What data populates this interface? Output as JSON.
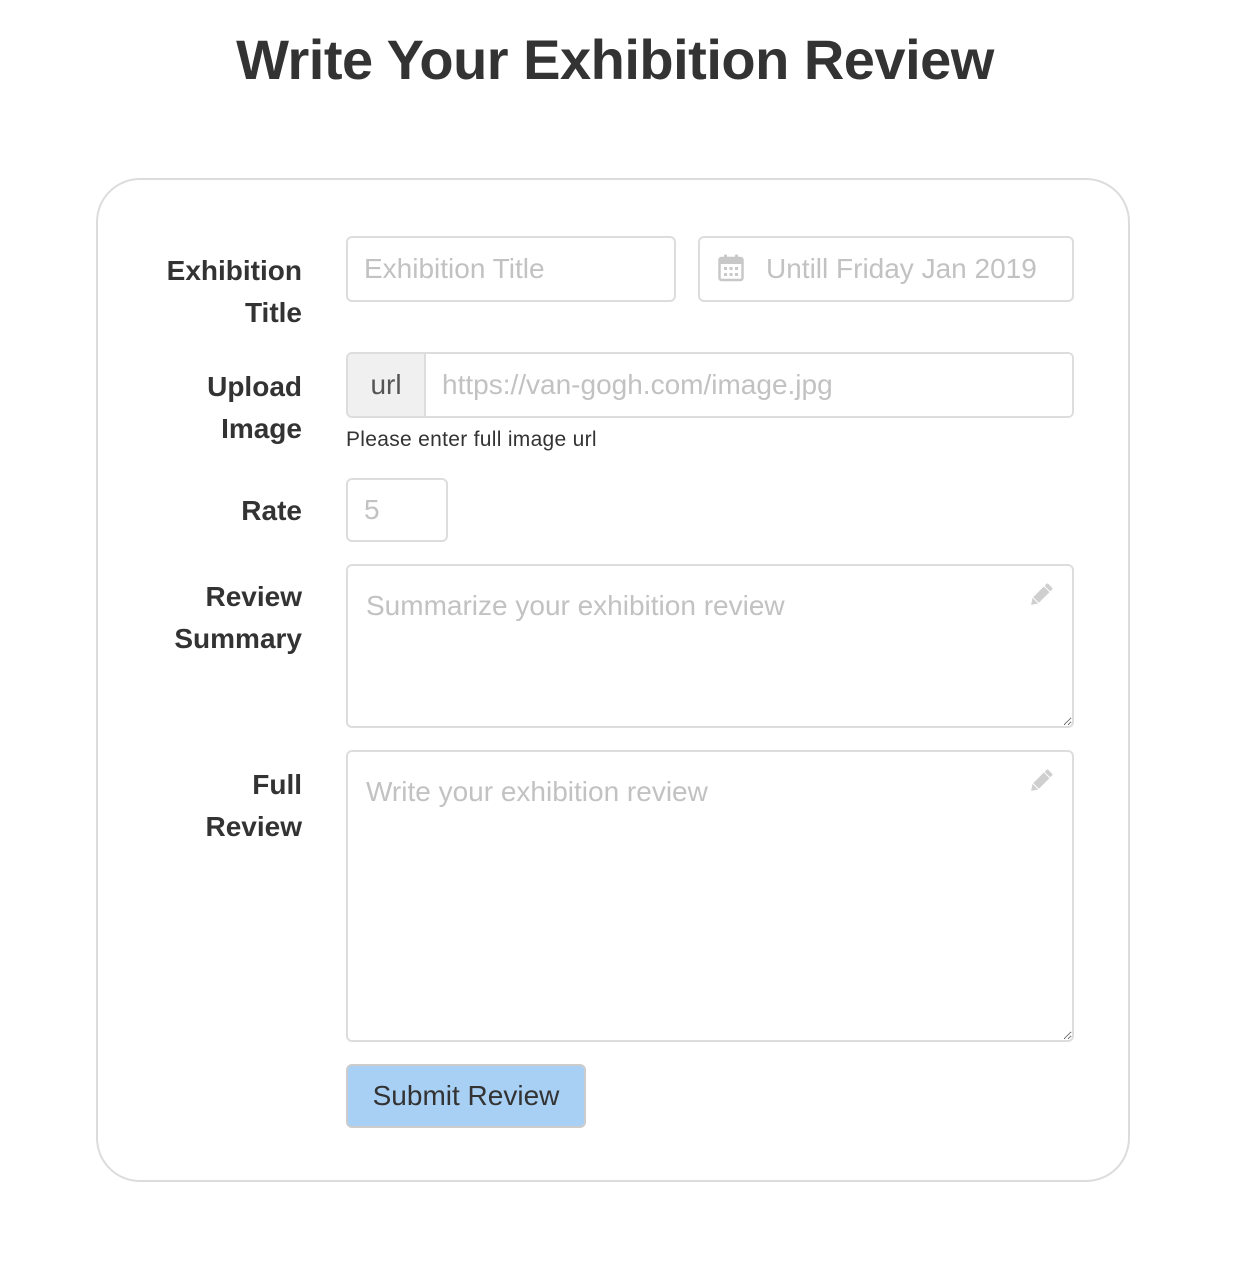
{
  "page": {
    "title": "Write Your Exhibition Review"
  },
  "form": {
    "labels": {
      "exhibition_title": "Exhibition\nTitle",
      "upload_image": "Upload\nImage",
      "rate": "Rate",
      "review_summary": "Review\nSummary",
      "full_review": "Full\nReview"
    },
    "title_input": {
      "value": "",
      "placeholder": "Exhibition Title"
    },
    "date_input": {
      "value": "",
      "placeholder": "Untill Friday Jan 2019",
      "icon": "calendar-icon"
    },
    "image_url": {
      "addon": "url",
      "value": "",
      "placeholder": "https://van-gogh.com/image.jpg",
      "help": "Please enter full image url"
    },
    "rate_input": {
      "value": "",
      "placeholder": "5"
    },
    "summary": {
      "value": "",
      "placeholder": "Summarize your exhibition review",
      "icon": "pencil-icon"
    },
    "full_review": {
      "value": "",
      "placeholder": "Write your exhibition review",
      "icon": "pencil-icon"
    },
    "submit_label": "Submit Review"
  },
  "colors": {
    "text": "#333333",
    "placeholder": "#c2c2c2",
    "border": "#dddddd",
    "addon_bg": "#f0f0f0",
    "button_bg": "#a8d0f5"
  }
}
